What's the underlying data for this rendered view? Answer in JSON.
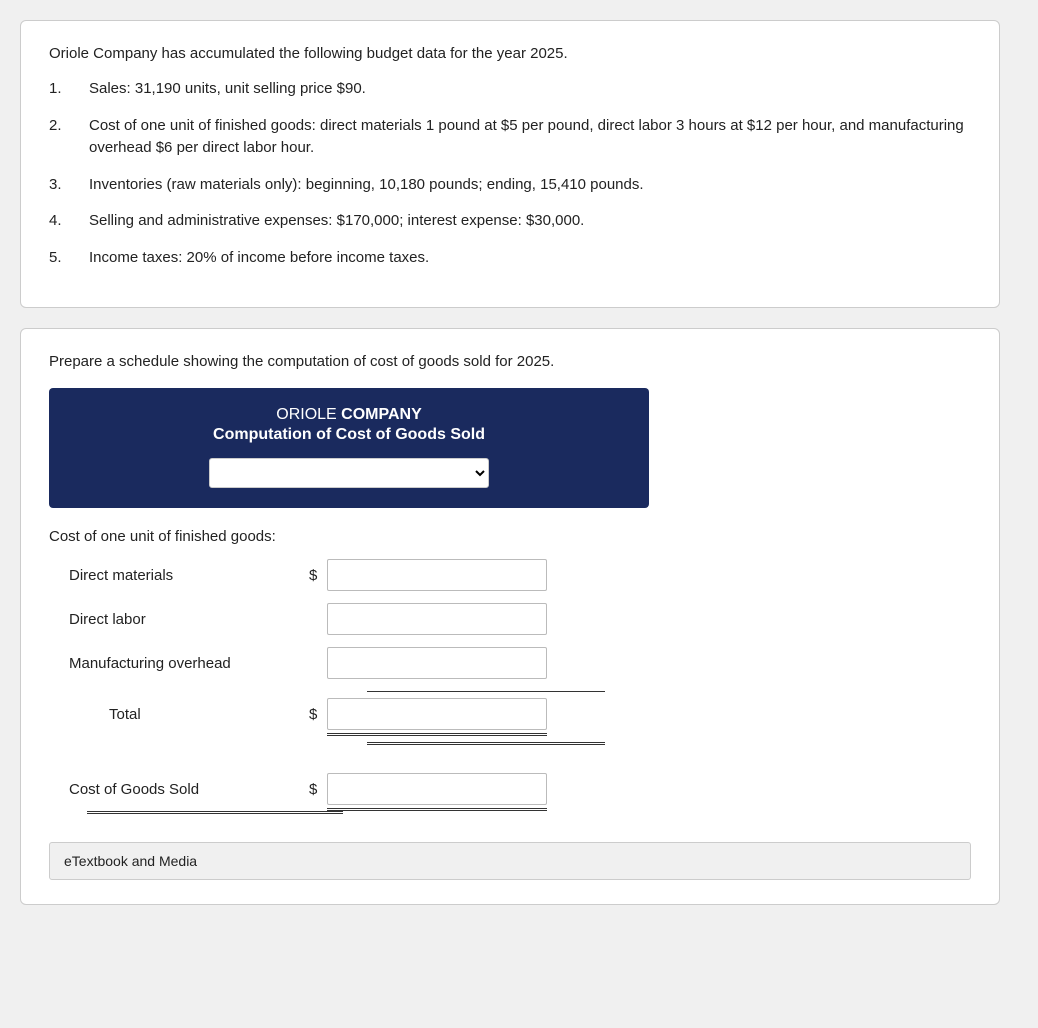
{
  "intro": {
    "text": "Oriole Company has accumulated the following budget data for the year 2025.",
    "items": [
      {
        "num": "1.",
        "text": "Sales: 31,190 units, unit selling price $90."
      },
      {
        "num": "2.",
        "text": "Cost of one unit of finished goods: direct materials 1 pound at $5 per pound, direct labor 3 hours at $12 per hour, and manufacturing overhead $6 per direct labor hour."
      },
      {
        "num": "3.",
        "text": "Inventories (raw materials only): beginning, 10,180 pounds; ending, 15,410 pounds."
      },
      {
        "num": "4.",
        "text": "Selling and administrative expenses: $170,000; interest expense: $30,000."
      },
      {
        "num": "5.",
        "text": "Income taxes: 20% of income before income taxes."
      }
    ]
  },
  "section2": {
    "prepare_text": "Prepare a schedule showing the computation of cost of goods sold for 2025.",
    "schedule": {
      "title_light": "ORIOLE ",
      "title_bold": "COMPANY",
      "subtitle": "Computation of Cost of Goods Sold",
      "dropdown_placeholder": ""
    },
    "form": {
      "section_label": "Cost of one unit of finished goods:",
      "direct_materials_label": "Direct materials",
      "direct_labor_label": "Direct labor",
      "manufacturing_overhead_label": "Manufacturing overhead",
      "total_label": "Total",
      "cogs_label": "Cost of Goods Sold"
    },
    "etextbook_label": "eTextbook and Media"
  }
}
